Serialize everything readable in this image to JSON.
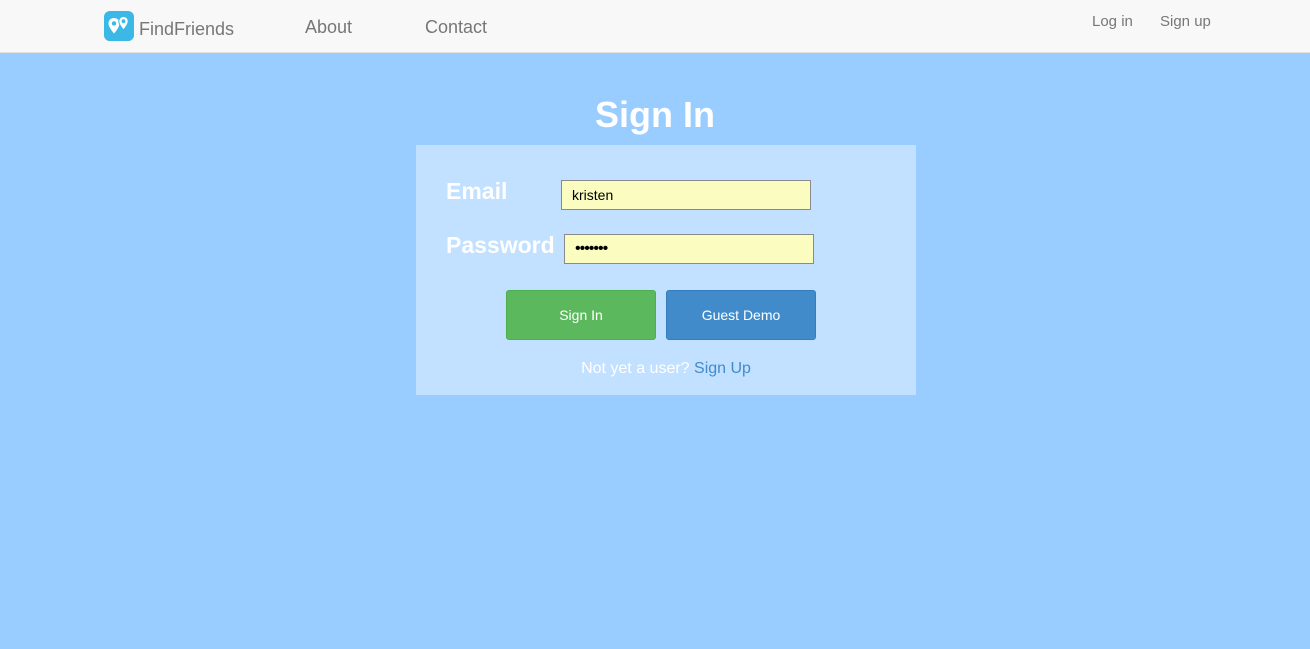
{
  "nav": {
    "brand": "FindFriends",
    "links": [
      "About",
      "Contact"
    ],
    "right_links": [
      "Log in",
      "Sign up"
    ]
  },
  "page": {
    "title": "Sign In"
  },
  "form": {
    "email_label": "Email",
    "email_value": "kristen",
    "password_label": "Password",
    "password_value": "•••••••",
    "sign_in_button": "Sign In",
    "guest_button": "Guest Demo",
    "footer_text": "Not yet a user? ",
    "footer_link": "Sign Up"
  },
  "colors": {
    "background": "#99ccff",
    "panel": "#c2e0ff",
    "navbar": "#f8f8f8",
    "success": "#5cb85c",
    "primary": "#428bca",
    "input_bg": "#fafcc0"
  },
  "icons": {
    "brand_logo": "map-pin-pair-icon"
  }
}
